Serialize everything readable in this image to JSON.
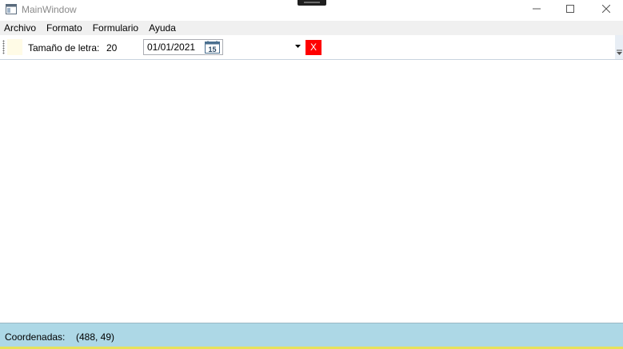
{
  "window": {
    "title": "MainWindow",
    "icon": "app-window-icon",
    "controls": {
      "minimize_icon": "minimize-icon",
      "maximize_icon": "maximize-icon",
      "close_icon": "close-icon"
    }
  },
  "menu": {
    "items": [
      {
        "label": "Archivo"
      },
      {
        "label": "Formato"
      },
      {
        "label": "Formulario"
      },
      {
        "label": "Ayuda"
      }
    ]
  },
  "toolbar": {
    "font_size_label": "Tamaño de letra:",
    "font_size_value": "20",
    "date_value": "01/01/2021",
    "calendar_icon": "calendar-icon",
    "calendar_day": "15",
    "clear_button_label": "X",
    "colors": {
      "swatch": "#fffbe6",
      "clear_button": "#ff0000"
    }
  },
  "status": {
    "coords_label": "Coordenadas:",
    "coords_value": "(488, 49)",
    "background": "#add8e6"
  }
}
